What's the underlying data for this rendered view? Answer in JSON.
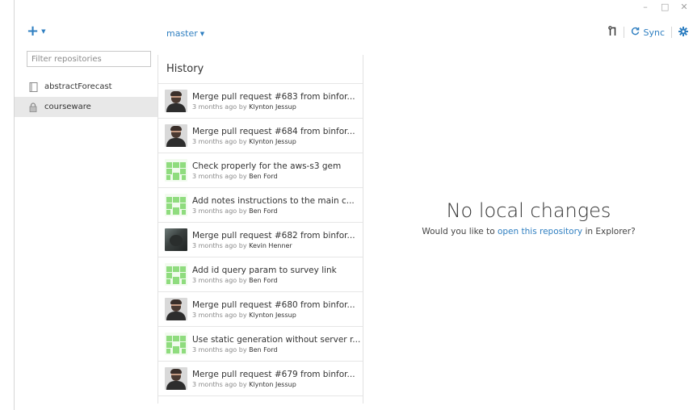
{
  "window": {
    "controls": [
      "–",
      "□",
      "✕"
    ]
  },
  "sidebar": {
    "add_icon": "plus-icon",
    "filter_placeholder": "Filter repositories",
    "repos": [
      {
        "label": "abstractForecast",
        "icon": "book-icon",
        "selected": false
      },
      {
        "label": "courseware",
        "icon": "lock-icon",
        "selected": true
      }
    ]
  },
  "topbar": {
    "branch": "master",
    "sync_label": "Sync",
    "icons": [
      "pull-request-icon",
      "sync-icon",
      "gear-icon"
    ]
  },
  "history": {
    "title": "History",
    "by": "by",
    "commits": [
      {
        "title": "Merge pull request #683 from binfor...",
        "time": "3 months ago",
        "author": "Klynton Jessup",
        "avatar": "person"
      },
      {
        "title": "Merge pull request #684 from binfor...",
        "time": "3 months ago",
        "author": "Klynton Jessup",
        "avatar": "person"
      },
      {
        "title": "Check properly for the aws-s3 gem",
        "time": "3 months ago",
        "author": "Ben Ford",
        "avatar": "identicon"
      },
      {
        "title": "Add notes instructions to the main c...",
        "time": "3 months ago",
        "author": "Ben Ford",
        "avatar": "identicon"
      },
      {
        "title": "Merge pull request #682 from binfor...",
        "time": "3 months ago",
        "author": "Kevin Henner",
        "avatar": "photo"
      },
      {
        "title": "Add id query param to survey link",
        "time": "3 months ago",
        "author": "Ben Ford",
        "avatar": "identicon"
      },
      {
        "title": "Merge pull request #680 from binfor...",
        "time": "3 months ago",
        "author": "Klynton Jessup",
        "avatar": "person"
      },
      {
        "title": "Use static generation without server r...",
        "time": "3 months ago",
        "author": "Ben Ford",
        "avatar": "identicon"
      },
      {
        "title": "Merge pull request #679 from binfor...",
        "time": "3 months ago",
        "author": "Klynton Jessup",
        "avatar": "person"
      }
    ]
  },
  "main": {
    "heading": "No local changes",
    "prompt_before": "Would you like to",
    "prompt_link": "open this repository",
    "prompt_after": "in Explorer?"
  },
  "colors": {
    "accent": "#2f7fc1",
    "selected_bg": "#e8e8e8",
    "identicon": "#8fdc7e"
  }
}
